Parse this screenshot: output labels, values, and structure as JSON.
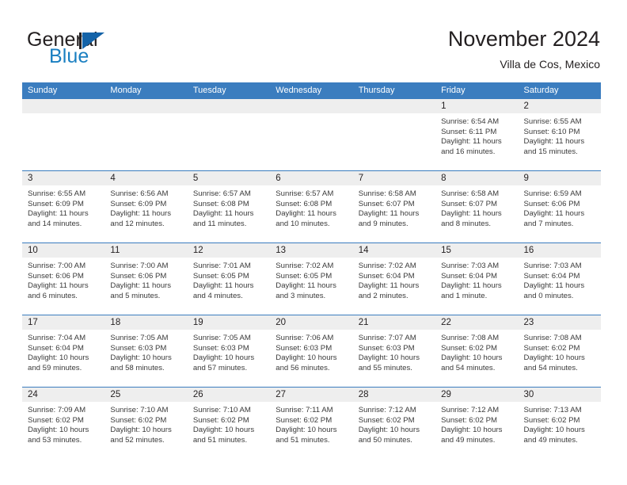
{
  "brand": {
    "name_part1": "General",
    "name_part2": "Blue",
    "flag_icon": "triangle-flag-icon"
  },
  "header": {
    "title": "November 2024",
    "subtitle": "Villa de Cos, Mexico"
  },
  "colors": {
    "header_blue": "#3b7dbf",
    "brand_blue": "#1a7fc1",
    "daynum_band": "#eeeeee",
    "text": "#231f20",
    "body_text": "#3a3a3a"
  },
  "calendar": {
    "weekdays": [
      "Sunday",
      "Monday",
      "Tuesday",
      "Wednesday",
      "Thursday",
      "Friday",
      "Saturday"
    ],
    "weeks": [
      [
        {
          "day": "",
          "sunrise": "",
          "sunset": "",
          "daylight1": "",
          "daylight2": "",
          "empty": true
        },
        {
          "day": "",
          "sunrise": "",
          "sunset": "",
          "daylight1": "",
          "daylight2": "",
          "empty": true
        },
        {
          "day": "",
          "sunrise": "",
          "sunset": "",
          "daylight1": "",
          "daylight2": "",
          "empty": true
        },
        {
          "day": "",
          "sunrise": "",
          "sunset": "",
          "daylight1": "",
          "daylight2": "",
          "empty": true
        },
        {
          "day": "",
          "sunrise": "",
          "sunset": "",
          "daylight1": "",
          "daylight2": "",
          "empty": true
        },
        {
          "day": "1",
          "sunrise": "Sunrise: 6:54 AM",
          "sunset": "Sunset: 6:11 PM",
          "daylight1": "Daylight: 11 hours",
          "daylight2": "and 16 minutes.",
          "empty": false
        },
        {
          "day": "2",
          "sunrise": "Sunrise: 6:55 AM",
          "sunset": "Sunset: 6:10 PM",
          "daylight1": "Daylight: 11 hours",
          "daylight2": "and 15 minutes.",
          "empty": false
        }
      ],
      [
        {
          "day": "3",
          "sunrise": "Sunrise: 6:55 AM",
          "sunset": "Sunset: 6:09 PM",
          "daylight1": "Daylight: 11 hours",
          "daylight2": "and 14 minutes.",
          "empty": false
        },
        {
          "day": "4",
          "sunrise": "Sunrise: 6:56 AM",
          "sunset": "Sunset: 6:09 PM",
          "daylight1": "Daylight: 11 hours",
          "daylight2": "and 12 minutes.",
          "empty": false
        },
        {
          "day": "5",
          "sunrise": "Sunrise: 6:57 AM",
          "sunset": "Sunset: 6:08 PM",
          "daylight1": "Daylight: 11 hours",
          "daylight2": "and 11 minutes.",
          "empty": false
        },
        {
          "day": "6",
          "sunrise": "Sunrise: 6:57 AM",
          "sunset": "Sunset: 6:08 PM",
          "daylight1": "Daylight: 11 hours",
          "daylight2": "and 10 minutes.",
          "empty": false
        },
        {
          "day": "7",
          "sunrise": "Sunrise: 6:58 AM",
          "sunset": "Sunset: 6:07 PM",
          "daylight1": "Daylight: 11 hours",
          "daylight2": "and 9 minutes.",
          "empty": false
        },
        {
          "day": "8",
          "sunrise": "Sunrise: 6:58 AM",
          "sunset": "Sunset: 6:07 PM",
          "daylight1": "Daylight: 11 hours",
          "daylight2": "and 8 minutes.",
          "empty": false
        },
        {
          "day": "9",
          "sunrise": "Sunrise: 6:59 AM",
          "sunset": "Sunset: 6:06 PM",
          "daylight1": "Daylight: 11 hours",
          "daylight2": "and 7 minutes.",
          "empty": false
        }
      ],
      [
        {
          "day": "10",
          "sunrise": "Sunrise: 7:00 AM",
          "sunset": "Sunset: 6:06 PM",
          "daylight1": "Daylight: 11 hours",
          "daylight2": "and 6 minutes.",
          "empty": false
        },
        {
          "day": "11",
          "sunrise": "Sunrise: 7:00 AM",
          "sunset": "Sunset: 6:06 PM",
          "daylight1": "Daylight: 11 hours",
          "daylight2": "and 5 minutes.",
          "empty": false
        },
        {
          "day": "12",
          "sunrise": "Sunrise: 7:01 AM",
          "sunset": "Sunset: 6:05 PM",
          "daylight1": "Daylight: 11 hours",
          "daylight2": "and 4 minutes.",
          "empty": false
        },
        {
          "day": "13",
          "sunrise": "Sunrise: 7:02 AM",
          "sunset": "Sunset: 6:05 PM",
          "daylight1": "Daylight: 11 hours",
          "daylight2": "and 3 minutes.",
          "empty": false
        },
        {
          "day": "14",
          "sunrise": "Sunrise: 7:02 AM",
          "sunset": "Sunset: 6:04 PM",
          "daylight1": "Daylight: 11 hours",
          "daylight2": "and 2 minutes.",
          "empty": false
        },
        {
          "day": "15",
          "sunrise": "Sunrise: 7:03 AM",
          "sunset": "Sunset: 6:04 PM",
          "daylight1": "Daylight: 11 hours",
          "daylight2": "and 1 minute.",
          "empty": false
        },
        {
          "day": "16",
          "sunrise": "Sunrise: 7:03 AM",
          "sunset": "Sunset: 6:04 PM",
          "daylight1": "Daylight: 11 hours",
          "daylight2": "and 0 minutes.",
          "empty": false
        }
      ],
      [
        {
          "day": "17",
          "sunrise": "Sunrise: 7:04 AM",
          "sunset": "Sunset: 6:04 PM",
          "daylight1": "Daylight: 10 hours",
          "daylight2": "and 59 minutes.",
          "empty": false
        },
        {
          "day": "18",
          "sunrise": "Sunrise: 7:05 AM",
          "sunset": "Sunset: 6:03 PM",
          "daylight1": "Daylight: 10 hours",
          "daylight2": "and 58 minutes.",
          "empty": false
        },
        {
          "day": "19",
          "sunrise": "Sunrise: 7:05 AM",
          "sunset": "Sunset: 6:03 PM",
          "daylight1": "Daylight: 10 hours",
          "daylight2": "and 57 minutes.",
          "empty": false
        },
        {
          "day": "20",
          "sunrise": "Sunrise: 7:06 AM",
          "sunset": "Sunset: 6:03 PM",
          "daylight1": "Daylight: 10 hours",
          "daylight2": "and 56 minutes.",
          "empty": false
        },
        {
          "day": "21",
          "sunrise": "Sunrise: 7:07 AM",
          "sunset": "Sunset: 6:03 PM",
          "daylight1": "Daylight: 10 hours",
          "daylight2": "and 55 minutes.",
          "empty": false
        },
        {
          "day": "22",
          "sunrise": "Sunrise: 7:08 AM",
          "sunset": "Sunset: 6:02 PM",
          "daylight1": "Daylight: 10 hours",
          "daylight2": "and 54 minutes.",
          "empty": false
        },
        {
          "day": "23",
          "sunrise": "Sunrise: 7:08 AM",
          "sunset": "Sunset: 6:02 PM",
          "daylight1": "Daylight: 10 hours",
          "daylight2": "and 54 minutes.",
          "empty": false
        }
      ],
      [
        {
          "day": "24",
          "sunrise": "Sunrise: 7:09 AM",
          "sunset": "Sunset: 6:02 PM",
          "daylight1": "Daylight: 10 hours",
          "daylight2": "and 53 minutes.",
          "empty": false
        },
        {
          "day": "25",
          "sunrise": "Sunrise: 7:10 AM",
          "sunset": "Sunset: 6:02 PM",
          "daylight1": "Daylight: 10 hours",
          "daylight2": "and 52 minutes.",
          "empty": false
        },
        {
          "day": "26",
          "sunrise": "Sunrise: 7:10 AM",
          "sunset": "Sunset: 6:02 PM",
          "daylight1": "Daylight: 10 hours",
          "daylight2": "and 51 minutes.",
          "empty": false
        },
        {
          "day": "27",
          "sunrise": "Sunrise: 7:11 AM",
          "sunset": "Sunset: 6:02 PM",
          "daylight1": "Daylight: 10 hours",
          "daylight2": "and 51 minutes.",
          "empty": false
        },
        {
          "day": "28",
          "sunrise": "Sunrise: 7:12 AM",
          "sunset": "Sunset: 6:02 PM",
          "daylight1": "Daylight: 10 hours",
          "daylight2": "and 50 minutes.",
          "empty": false
        },
        {
          "day": "29",
          "sunrise": "Sunrise: 7:12 AM",
          "sunset": "Sunset: 6:02 PM",
          "daylight1": "Daylight: 10 hours",
          "daylight2": "and 49 minutes.",
          "empty": false
        },
        {
          "day": "30",
          "sunrise": "Sunrise: 7:13 AM",
          "sunset": "Sunset: 6:02 PM",
          "daylight1": "Daylight: 10 hours",
          "daylight2": "and 49 minutes.",
          "empty": false
        }
      ]
    ]
  }
}
